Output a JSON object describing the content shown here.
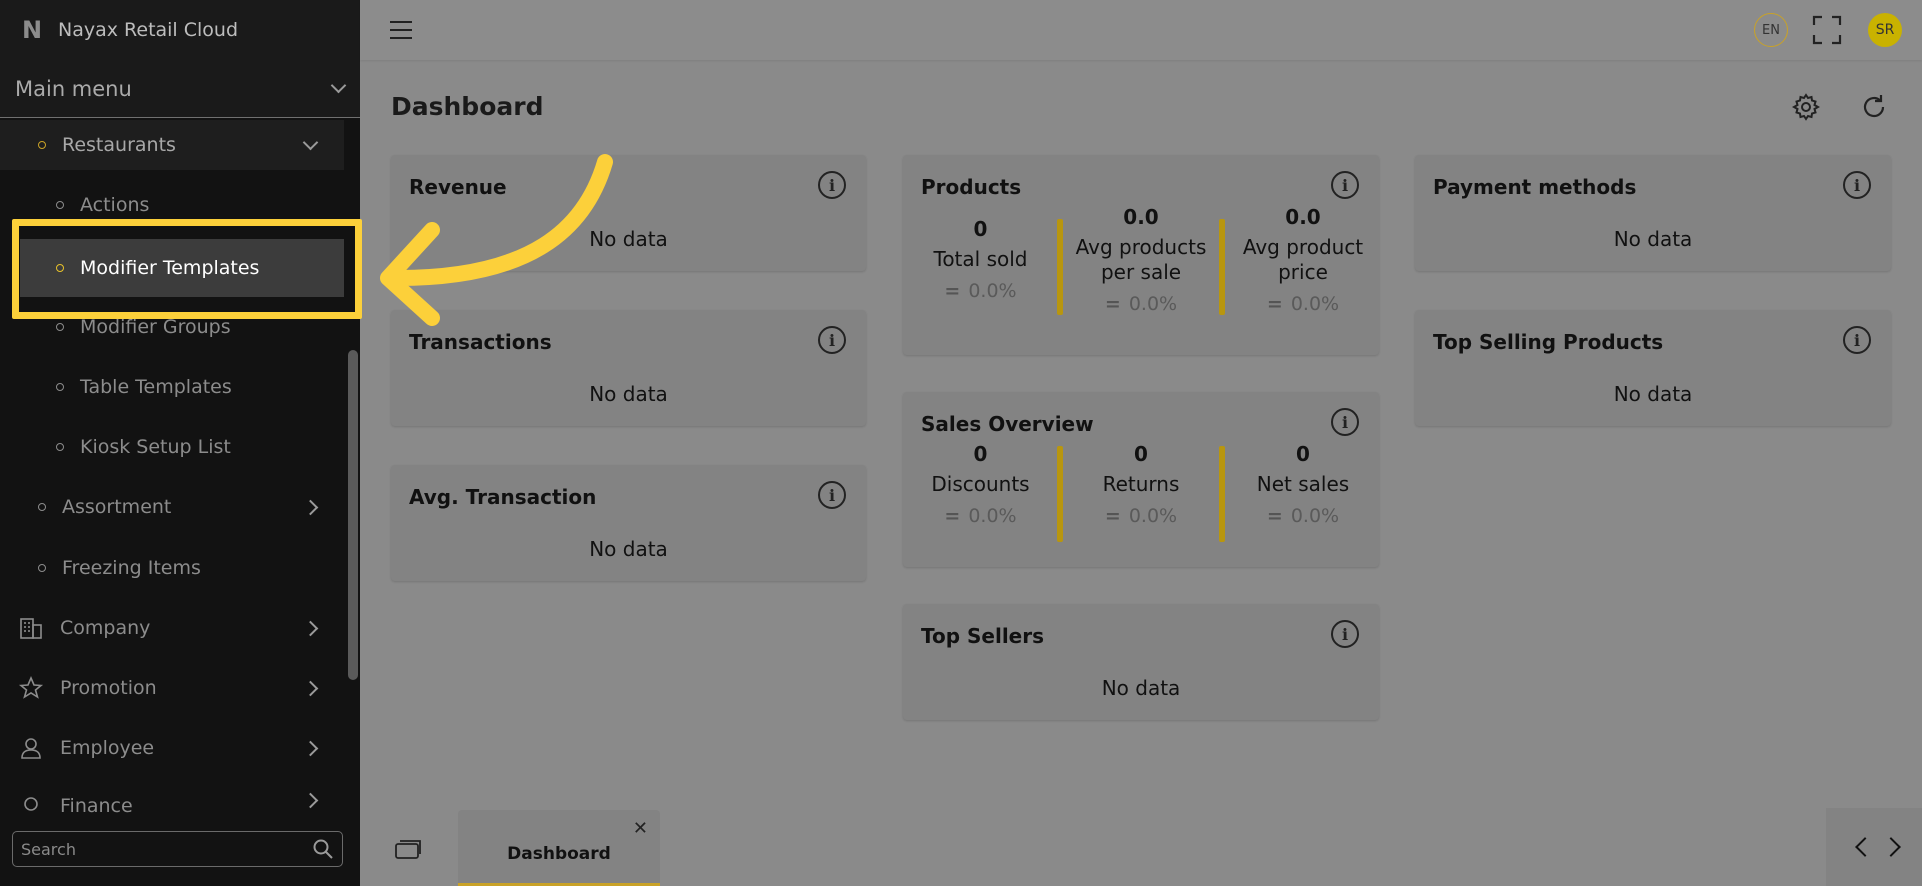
{
  "app": {
    "title": "Nayax Retail Cloud",
    "logo_letter": "N"
  },
  "sidebar": {
    "main_menu_label": "Main menu",
    "items": [
      {
        "label": "Restaurants"
      },
      {
        "label": "Actions"
      },
      {
        "label": "Modifier Templates"
      },
      {
        "label": "Modifier Groups"
      },
      {
        "label": "Table Templates"
      },
      {
        "label": "Kiosk Setup List"
      },
      {
        "label": "Assortment"
      },
      {
        "label": "Freezing Items"
      },
      {
        "label": "Company"
      },
      {
        "label": "Promotion"
      },
      {
        "label": "Employee"
      },
      {
        "label": "Finance"
      }
    ],
    "search_placeholder": "Search"
  },
  "topbar": {
    "language": "EN",
    "user_initials": "SR"
  },
  "page": {
    "title": "Dashboard"
  },
  "cards": {
    "revenue": {
      "title": "Revenue",
      "body": "No data"
    },
    "transactions": {
      "title": "Transactions",
      "body": "No data"
    },
    "avg_transaction": {
      "title": "Avg. Transaction",
      "body": "No data"
    },
    "products": {
      "title": "Products",
      "metrics": [
        {
          "value": "0",
          "label": "Total sold",
          "change": "0.0%"
        },
        {
          "value": "0.0",
          "label": "Avg products per sale",
          "change": "0.0%"
        },
        {
          "value": "0.0",
          "label": "Avg product price",
          "change": "0.0%"
        }
      ]
    },
    "sales_overview": {
      "title": "Sales Overview",
      "metrics": [
        {
          "value": "0",
          "label": "Discounts",
          "change": "0.0%"
        },
        {
          "value": "0",
          "label": "Returns",
          "change": "0.0%"
        },
        {
          "value": "0",
          "label": "Net sales",
          "change": "0.0%"
        }
      ]
    },
    "top_sellers": {
      "title": "Top Sellers",
      "body": "No data"
    },
    "payment_methods": {
      "title": "Payment methods",
      "body": "No data"
    },
    "top_selling_products": {
      "title": "Top Selling Products",
      "body": "No data"
    }
  },
  "bottombar": {
    "tab_label": "Dashboard"
  },
  "colors": {
    "accent": "#fcd03a",
    "divider": "#b8960f",
    "sidebar_bg": "#121212"
  }
}
